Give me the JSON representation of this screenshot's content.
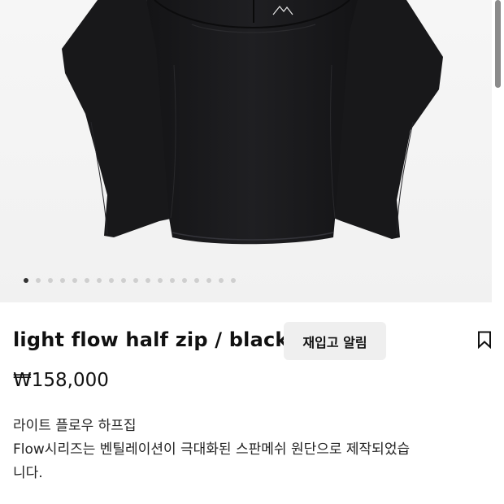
{
  "product": {
    "title": "light flow half zip / black",
    "price": "₩158,000",
    "restock_button_label": "재입고 알림",
    "description": {
      "line1": "라이트 플로우 하프집",
      "line2": "Flow시리즈는 벤틸레이션이 극대화된 스판메쉬 원단으로 제작되었습",
      "line3": "니다."
    }
  },
  "gallery": {
    "image_count": 18,
    "active_index": 0,
    "garment_color": "#1c1c1e"
  },
  "icons": {
    "bookmark": "bookmark-outline-icon"
  }
}
